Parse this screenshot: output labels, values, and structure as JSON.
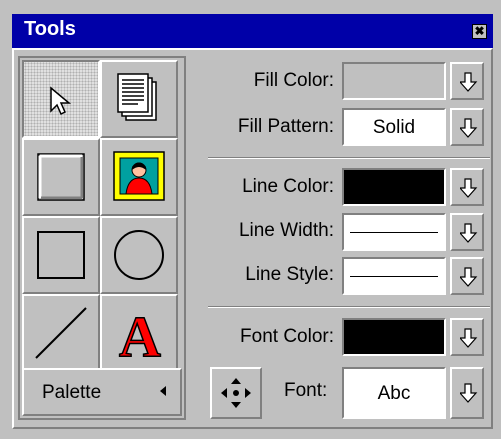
{
  "window": {
    "title": "Tools",
    "close_glyph": "✖"
  },
  "tools": [
    {
      "name": "pointer",
      "icon": "arrow-pointer-icon",
      "selected": true
    },
    {
      "name": "document",
      "icon": "stacked-pages-icon"
    },
    {
      "name": "rectangle-3d",
      "icon": "raised-rectangle-icon"
    },
    {
      "name": "picture",
      "icon": "framed-picture-icon"
    },
    {
      "name": "rectangle",
      "icon": "rectangle-icon"
    },
    {
      "name": "ellipse",
      "icon": "circle-icon"
    },
    {
      "name": "line",
      "icon": "line-icon"
    },
    {
      "name": "text",
      "icon": "letter-a-icon",
      "glyph": "A"
    }
  ],
  "palette": {
    "label": "Palette"
  },
  "properties": {
    "fill_color": {
      "label": "Fill Color:",
      "value": "",
      "color": "#c0c0c0"
    },
    "fill_pattern": {
      "label": "Fill Pattern:",
      "value": "Solid"
    },
    "line_color": {
      "label": "Line Color:",
      "color": "#000000"
    },
    "line_width": {
      "label": "Line Width:"
    },
    "line_style": {
      "label": "Line Style:"
    },
    "font_color": {
      "label": "Font Color:",
      "color": "#000000"
    },
    "font": {
      "label": "Font:",
      "value": "Abc"
    }
  },
  "colors": {
    "titlebar": "#0000a8",
    "face": "#c0c0c0",
    "text_a": "#ff0000"
  }
}
